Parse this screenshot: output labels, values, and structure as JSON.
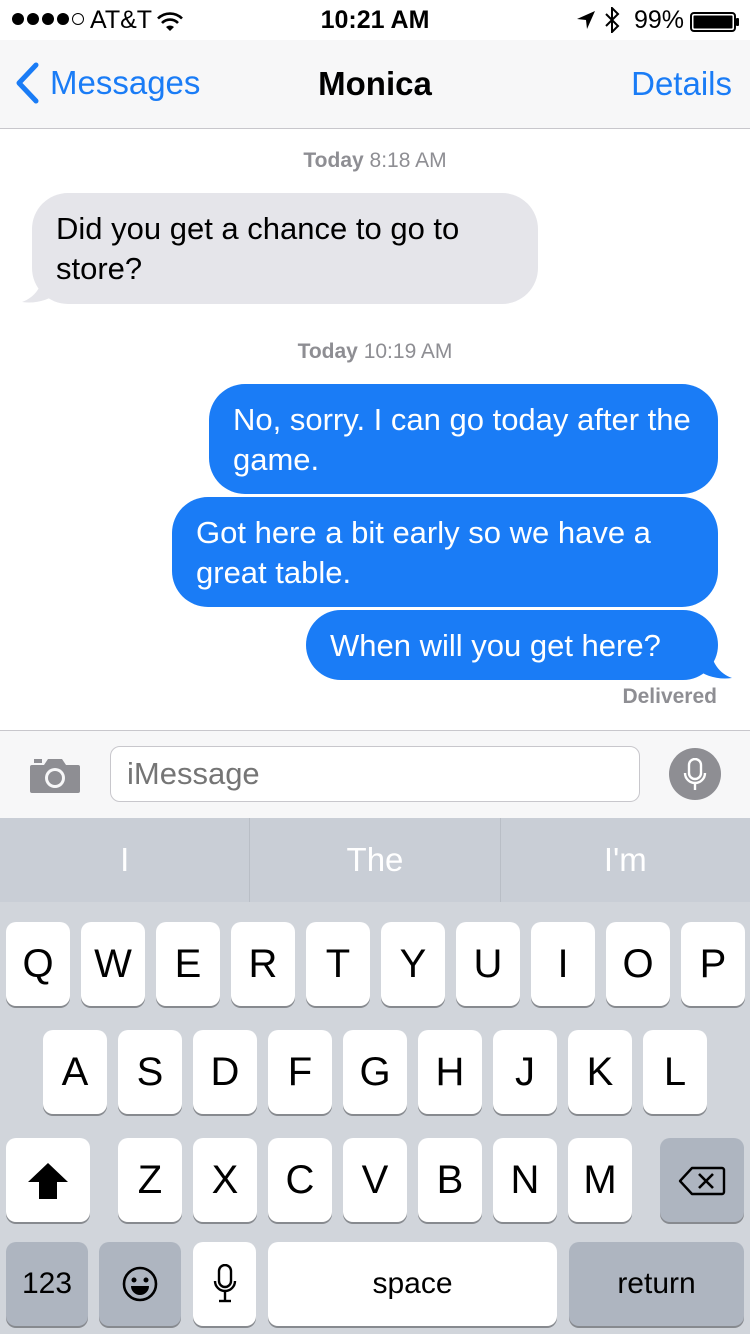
{
  "status_bar": {
    "carrier": "AT&T",
    "time": "10:21 AM",
    "battery_pct": "99%",
    "signal_bars": 4,
    "icons": [
      "signal-dots-icon",
      "wifi-icon",
      "location-arrow-icon",
      "bluetooth-icon",
      "battery-icon"
    ]
  },
  "nav": {
    "back_label": "Messages",
    "title": "Monica",
    "details_label": "Details"
  },
  "conversation": {
    "timestamps": [
      {
        "day": "Today",
        "time": "8:18 AM"
      },
      {
        "day": "Today",
        "time": "10:19 AM"
      }
    ],
    "messages": [
      {
        "from": "Monica",
        "direction": "incoming",
        "text": "Did you get a chance to go to store?"
      },
      {
        "from": "me",
        "direction": "outgoing",
        "text": "No, sorry. I can go today after the game."
      },
      {
        "from": "me",
        "direction": "outgoing",
        "text": "Got here a bit early so we have a great table."
      },
      {
        "from": "me",
        "direction": "outgoing",
        "text": "When will you get here?"
      }
    ],
    "delivery_status": "Delivered"
  },
  "input_bar": {
    "placeholder": "iMessage",
    "value": ""
  },
  "keyboard": {
    "suggestions": [
      "I",
      "The",
      "I'm"
    ],
    "row1": [
      "Q",
      "W",
      "E",
      "R",
      "T",
      "Y",
      "U",
      "I",
      "O",
      "P"
    ],
    "row2": [
      "A",
      "S",
      "D",
      "F",
      "G",
      "H",
      "J",
      "K",
      "L"
    ],
    "row3": [
      "Z",
      "X",
      "C",
      "V",
      "B",
      "N",
      "M"
    ],
    "numbers_label": "123",
    "space_label": "space",
    "return_label": "return"
  },
  "colors": {
    "accent": "#1a7cf6",
    "incoming_bubble": "#e5e5ea",
    "outgoing_bubble": "#1a7cf6",
    "keyboard_bg": "#d1d5db"
  }
}
